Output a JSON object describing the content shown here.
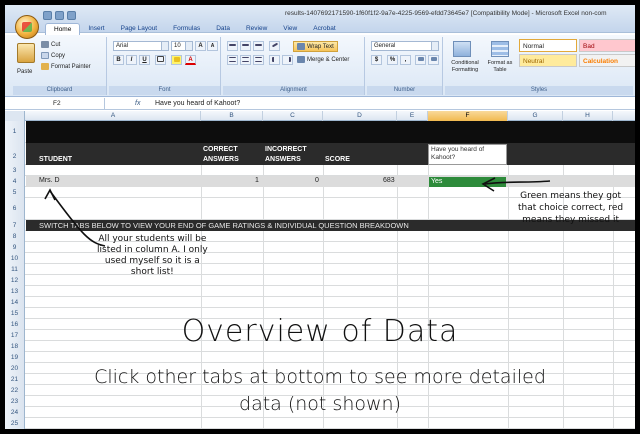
{
  "window": {
    "title": "results-1407692171590-1f60f1f2-9a7e-4225-9569-efdd73645e7 [Compatibility Mode] - Microsoft Excel non-com"
  },
  "ribbon": {
    "tabs": [
      "Home",
      "Insert",
      "Page Layout",
      "Formulas",
      "Data",
      "Review",
      "View",
      "Acrobat"
    ],
    "active_tab": "Home",
    "clipboard": {
      "paste": "Paste",
      "cut": "Cut",
      "copy": "Copy",
      "format_painter": "Format Painter",
      "label": "Clipboard"
    },
    "font": {
      "name": "Arial",
      "size": "10",
      "bold": "B",
      "italic": "I",
      "underline": "U",
      "grow": "A",
      "shrink": "A",
      "color_a": "A",
      "label": "Font"
    },
    "alignment": {
      "wrap_text": "Wrap Text",
      "merge_center": "Merge & Center",
      "label": "Alignment"
    },
    "number": {
      "format": "General",
      "currency": "$",
      "percent": "%",
      "comma": ",",
      "label": "Number"
    },
    "styles": {
      "conditional": "Conditional Formatting",
      "format_table": "Format as Table",
      "normal": "Normal",
      "bad": "Bad",
      "neutral": "Neutral",
      "calculation": "Calculation",
      "label": "Styles"
    }
  },
  "formula_bar": {
    "name_box": "F2",
    "fx": "fx",
    "formula": "Have you heard of Kahoot?"
  },
  "columns": [
    "A",
    "B",
    "C",
    "D",
    "E",
    "F",
    "G",
    "H"
  ],
  "selected_column": "F",
  "rows": [
    "1",
    "2",
    "3",
    "4",
    "5",
    "6",
    "7",
    "8",
    "9",
    "10",
    "11",
    "12",
    "13",
    "14",
    "15",
    "16",
    "17",
    "18",
    "19",
    "20",
    "21",
    "22",
    "23",
    "24",
    "25"
  ],
  "sheet": {
    "student_header": "STUDENT",
    "correct_header_1": "CORRECT",
    "correct_header_2": "ANSWERS",
    "incorrect_header_1": "INCORRECT",
    "incorrect_header_2": "ANSWERS",
    "score_header": "SCORE",
    "question_header": "Have you heard of Kahoot?",
    "student_name": "Mrs. D",
    "correct": "1",
    "incorrect": "0",
    "score": "683",
    "answer": "Yes",
    "row7_text": "SWITCH TABS BELOW TO VIEW YOUR END OF GAME RATINGS & INDIVIDUAL QUESTION BREAKDOWN"
  },
  "annotations": {
    "students_note": [
      "All your students will be",
      "listed in column A. I only",
      "used myself so it is a",
      "short list!"
    ],
    "color_note": [
      "Green means they got",
      "that choice correct, red",
      "means they missed it"
    ],
    "title": "Overview of Data",
    "subtitle_1": "Click other tabs at bottom to see more detailed",
    "subtitle_2": "data (not shown)"
  },
  "colors": {
    "answer_correct": "#2e8b3b",
    "header_band": "#2b2b2b",
    "selected_column": "#f1b94f"
  }
}
